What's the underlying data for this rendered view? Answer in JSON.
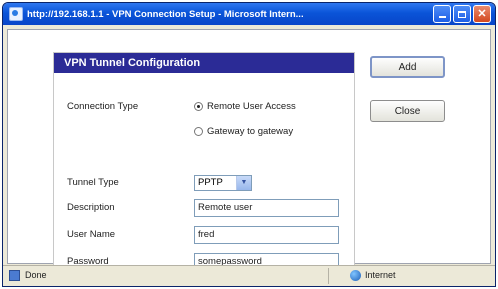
{
  "window": {
    "title": "http://192.168.1.1 - VPN Connection Setup - Microsoft Intern..."
  },
  "panel": {
    "header": "VPN Tunnel Configuration",
    "connection_type_label": "Connection Type",
    "radio_remote": "Remote User Access",
    "radio_gateway": "Gateway to gateway",
    "tunnel_type_label": "Tunnel Type",
    "tunnel_type_value": "PPTP",
    "description_label": "Description",
    "description_value": "Remote user",
    "username_label": "User Name",
    "username_value": "fred",
    "password_label": "Password",
    "password_value": "somepassword"
  },
  "buttons": {
    "add": "Add",
    "close": "Close"
  },
  "statusbar": {
    "status": "Done",
    "zone": "Internet"
  },
  "icons": {
    "titlebar": "ie-icon",
    "minimize": "minimize-icon",
    "maximize": "maximize-icon",
    "close": "close-icon",
    "status": "page-icon",
    "zone": "internet-zone-icon"
  },
  "colors": {
    "header_bg": "#2b2b96",
    "titlebar_bg": "#0a54d8"
  }
}
